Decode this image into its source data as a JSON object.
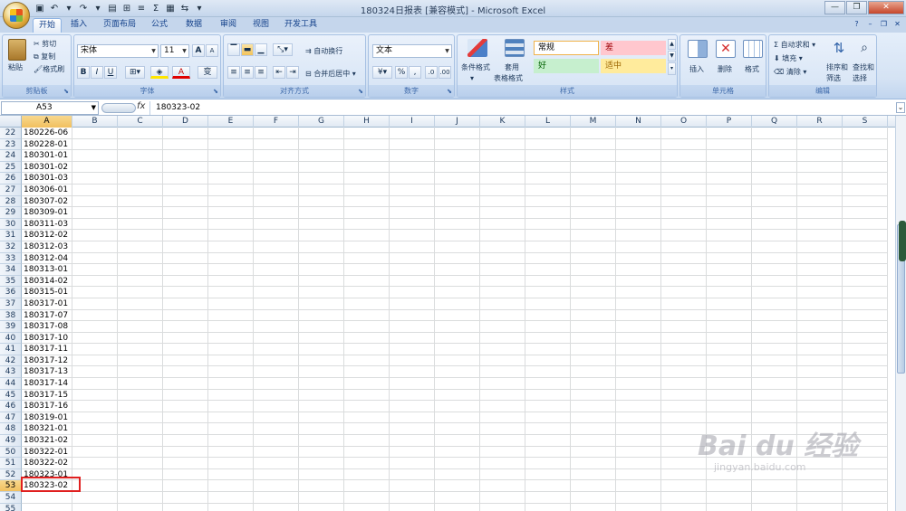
{
  "window": {
    "title": "180324日报表  [兼容模式] - Microsoft Excel",
    "minimize": "—",
    "restore": "❐",
    "close": "✕"
  },
  "tabs": [
    "开始",
    "插入",
    "页面布局",
    "公式",
    "数据",
    "审阅",
    "视图",
    "开发工具"
  ],
  "ribbon": {
    "clipboard": {
      "label": "剪贴板",
      "paste": "粘贴",
      "cut": "剪切",
      "copy": "复制",
      "format_painter": "格式刷"
    },
    "font": {
      "label": "字体",
      "name": "宋体",
      "size": "11",
      "bold": "B",
      "italic": "I",
      "underline": "U",
      "grow": "A",
      "shrink": "A",
      "font_color": "A",
      "phonetic": "变"
    },
    "alignment": {
      "label": "对齐方式",
      "wrap": "自动换行",
      "merge": "合并后居中"
    },
    "number": {
      "label": "数字",
      "format": "文本",
      "percent": "%",
      "comma": ","
    },
    "styles": {
      "label": "样式",
      "cond_format": "条件格式",
      "table_format_1": "套用",
      "table_format_2": "表格格式",
      "normal": "常规",
      "bad": "差",
      "good": "好",
      "neutral": "适中"
    },
    "cells": {
      "label": "单元格",
      "insert": "插入",
      "delete": "删除",
      "format": "格式"
    },
    "editing": {
      "label": "编辑",
      "autosum": "自动求和",
      "fill": "填充",
      "clear": "清除",
      "sort_1": "排序和",
      "sort_2": "筛选",
      "find_1": "查找和",
      "find_2": "选择"
    }
  },
  "formula_bar": {
    "name_box": "A53",
    "fx": "fx",
    "value": "180323-02"
  },
  "columns": [
    "A",
    "B",
    "C",
    "D",
    "E",
    "F",
    "G",
    "H",
    "I",
    "J",
    "K",
    "L",
    "M",
    "N",
    "O",
    "P",
    "Q",
    "R",
    "S"
  ],
  "selected_column": "A",
  "selected_row": "53",
  "rows": [
    {
      "n": "22",
      "a": "180226-06"
    },
    {
      "n": "23",
      "a": "180228-01"
    },
    {
      "n": "24",
      "a": "180301-01"
    },
    {
      "n": "25",
      "a": "180301-02"
    },
    {
      "n": "26",
      "a": "180301-03"
    },
    {
      "n": "27",
      "a": "180306-01"
    },
    {
      "n": "28",
      "a": "180307-02"
    },
    {
      "n": "29",
      "a": "180309-01"
    },
    {
      "n": "30",
      "a": "180311-03"
    },
    {
      "n": "31",
      "a": "180312-02"
    },
    {
      "n": "32",
      "a": "180312-03"
    },
    {
      "n": "33",
      "a": "180312-04"
    },
    {
      "n": "34",
      "a": "180313-01"
    },
    {
      "n": "35",
      "a": "180314-02"
    },
    {
      "n": "36",
      "a": "180315-01"
    },
    {
      "n": "37",
      "a": "180317-01"
    },
    {
      "n": "38",
      "a": "180317-07"
    },
    {
      "n": "39",
      "a": "180317-08"
    },
    {
      "n": "40",
      "a": "180317-10"
    },
    {
      "n": "41",
      "a": "180317-11"
    },
    {
      "n": "42",
      "a": "180317-12"
    },
    {
      "n": "43",
      "a": "180317-13"
    },
    {
      "n": "44",
      "a": "180317-14"
    },
    {
      "n": "45",
      "a": "180317-15"
    },
    {
      "n": "46",
      "a": "180317-16"
    },
    {
      "n": "47",
      "a": "180319-01"
    },
    {
      "n": "48",
      "a": "180321-01"
    },
    {
      "n": "49",
      "a": "180321-02"
    },
    {
      "n": "50",
      "a": "180322-01"
    },
    {
      "n": "51",
      "a": "180322-02"
    },
    {
      "n": "52",
      "a": "180323-01"
    },
    {
      "n": "53",
      "a": "180323-02"
    },
    {
      "n": "54",
      "a": ""
    },
    {
      "n": "55",
      "a": ""
    }
  ],
  "watermark": {
    "logo": "Bai du 经验",
    "url": "jingyan.baidu.com"
  }
}
